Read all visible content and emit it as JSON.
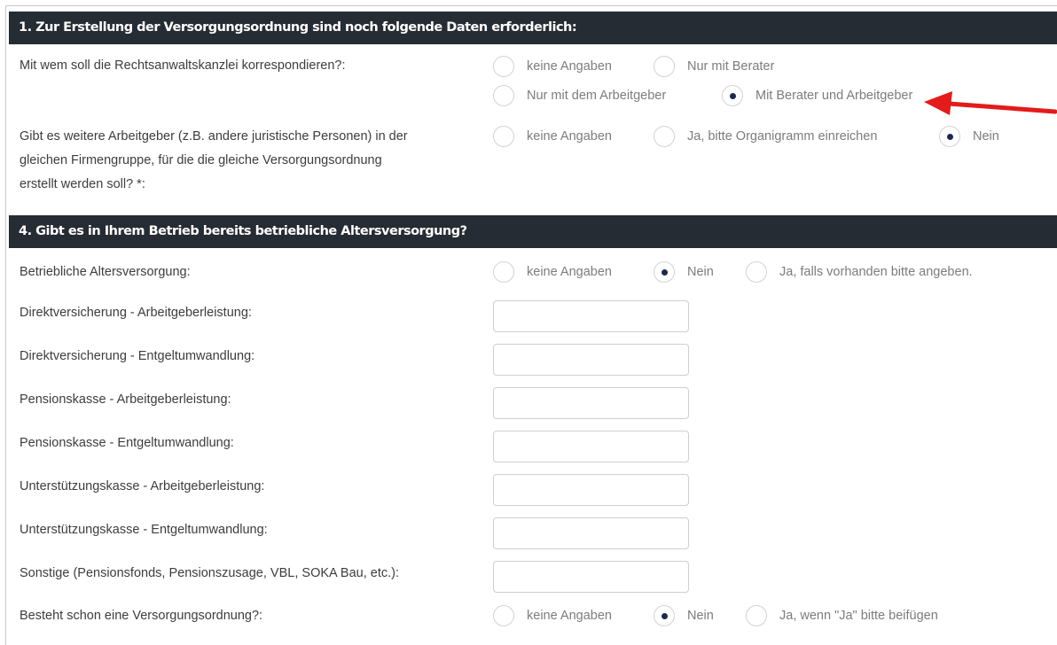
{
  "section1": {
    "title": "1. Zur Erstellung der Versorgungsordnung sind noch folgende Daten erforderlich:",
    "q_correspond": {
      "label": "Mit wem soll die Rechtsanwaltskanzlei korrespondieren?:",
      "options": [
        "keine Angaben",
        "Nur mit Berater",
        "Nur mit dem Arbeitgeber",
        "Mit Berater und Arbeitgeber"
      ],
      "selected": "Mit Berater und Arbeitgeber"
    },
    "q_employers": {
      "label_lines": [
        "Gibt es weitere Arbeitgeber (z.B. andere juristische Personen) in der",
        "gleichen Firmengruppe, für die die gleiche Versorgungsordnung",
        "erstellt werden soll? *:"
      ],
      "options": [
        "keine Angaben",
        "Ja, bitte Organigramm einreichen",
        "Nein"
      ],
      "selected": "Nein"
    }
  },
  "section4": {
    "title": "4. Gibt es in Ihrem Betrieb bereits betriebliche Altersversorgung?",
    "q_bav": {
      "label": "Betriebliche Altersversorgung:",
      "options": [
        "keine Angaben",
        "Nein",
        "Ja, falls vorhanden bitte angeben."
      ],
      "selected": "Nein"
    },
    "fields": [
      {
        "label": "Direktversicherung - Arbeitgeberleistung:",
        "value": ""
      },
      {
        "label": "Direktversicherung - Entgeltumwandlung:",
        "value": ""
      },
      {
        "label": "Pensionskasse - Arbeitgeberleistung:",
        "value": ""
      },
      {
        "label": "Pensionskasse - Entgeltumwandlung:",
        "value": ""
      },
      {
        "label": "Unterstützungskasse - Arbeitgeberleistung:",
        "value": ""
      },
      {
        "label": "Unterstützungskasse - Entgeltumwandlung:",
        "value": ""
      },
      {
        "label": "Sonstige (Pensionsfonds, Pensionszusage, VBL, SOKA Bau, etc.):",
        "value": ""
      }
    ],
    "q_existing": {
      "label": "Besteht schon eine Versorgungsordnung?:",
      "options": [
        "keine Angaben",
        "Nein",
        "Ja, wenn \"Ja\" bitte beifügen"
      ],
      "selected": "Nein"
    }
  },
  "colors": {
    "header_bg": "#262c33",
    "radio_dot": "#1c2850",
    "arrow": "#e31b1b"
  },
  "icons": {
    "annotation": "red-arrow-icon"
  }
}
